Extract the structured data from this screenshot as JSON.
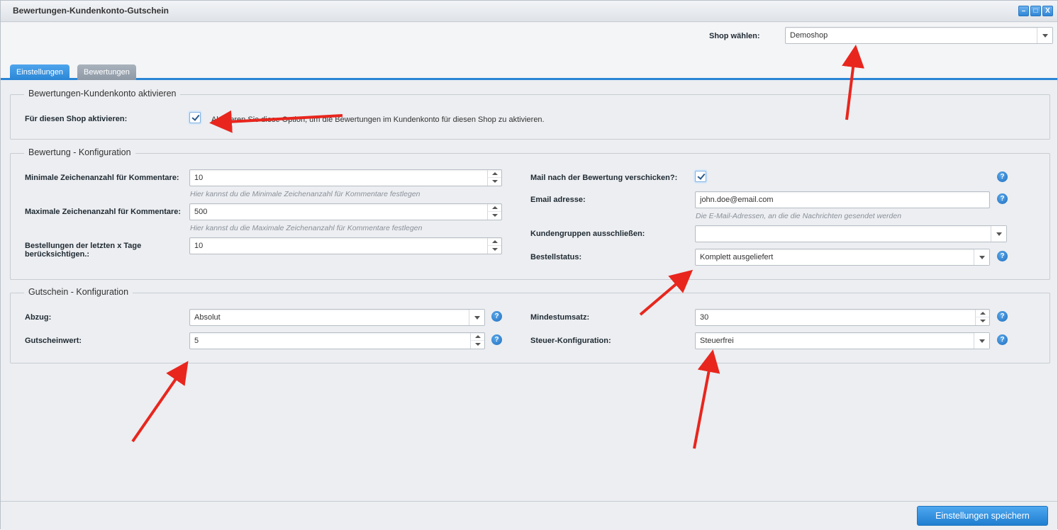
{
  "window": {
    "title": "Bewertungen-Kundenkonto-Gutschein"
  },
  "shop": {
    "label": "Shop wählen:",
    "value": "Demoshop"
  },
  "tabs": [
    {
      "label": "Einstellungen"
    },
    {
      "label": "Bewertungen"
    }
  ],
  "activate": {
    "legend": "Bewertungen-Kundenkonto aktivieren",
    "label": "Für diesen Shop aktivieren:",
    "description": "Aktivieren Sie diese Option, um die Bewertungen im Kundenkonto für diesen Shop zu aktivieren."
  },
  "rating": {
    "legend": "Bewertung - Konfiguration",
    "min_chars": {
      "label": "Minimale Zeichenanzahl für Kommentare:",
      "value": "10",
      "hint": "Hier kannst du die Minimale Zeichenanzahl für Kommentare festlegen"
    },
    "max_chars": {
      "label": "Maximale Zeichenanzahl für Kommentare:",
      "value": "500",
      "hint": "Hier kannst du die Maximale Zeichenanzahl für Kommentare festlegen"
    },
    "days": {
      "label_line1": "Bestellungen der letzten x Tage",
      "label_line2": "berücksichtigen.:",
      "value": "10"
    },
    "mail_after": {
      "label": "Mail nach der Bewertung verschicken?:",
      "checked": true
    },
    "email": {
      "label": "Email adresse:",
      "value": "john.doe@email.com",
      "hint": "Die E-Mail-Adressen, an die die Nachrichten gesendet werden"
    },
    "exclude_groups": {
      "label": "Kundengruppen ausschließen:",
      "value": ""
    },
    "order_status": {
      "label": "Bestellstatus:",
      "value": "Komplett ausgeliefert"
    }
  },
  "voucher": {
    "legend": "Gutschein - Konfiguration",
    "deduction": {
      "label": "Abzug:",
      "value": "Absolut"
    },
    "voucher_value": {
      "label": "Gutscheinwert:",
      "value": "5"
    },
    "min_revenue": {
      "label": "Mindestumsatz:",
      "value": "30"
    },
    "tax_config": {
      "label": "Steuer-Konfiguration:",
      "value": "Steuerfrei"
    }
  },
  "footer": {
    "save_label": "Einstellungen speichern"
  },
  "icons": {
    "help": "?",
    "minimize": "–",
    "maximize": "□",
    "close": "X"
  },
  "colors": {
    "accent": "#2a86d6",
    "annotation_arrow": "#e8261e"
  }
}
